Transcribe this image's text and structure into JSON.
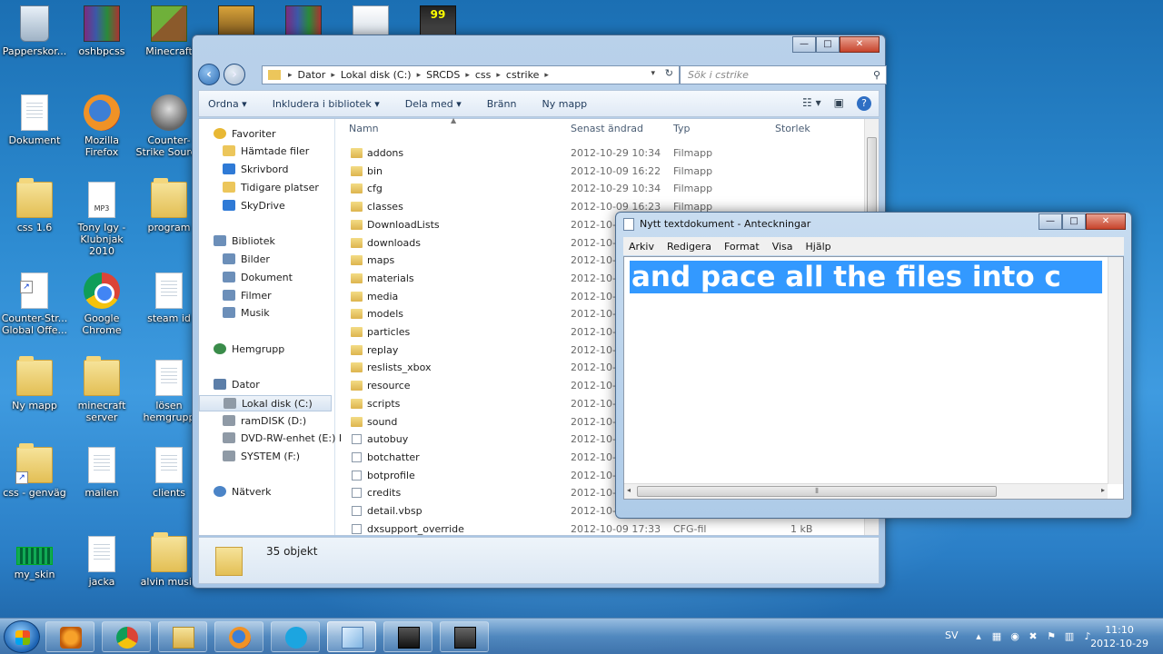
{
  "desktop": {
    "icons": [
      {
        "label": "Papperskor...",
        "kind": "trash"
      },
      {
        "label": "oshbpcss",
        "kind": "rar"
      },
      {
        "label": "Minecraft",
        "kind": "cube"
      },
      {
        "label": "",
        "kind": "game"
      },
      {
        "label": "",
        "kind": "rar"
      },
      {
        "label": "",
        "kind": "tv"
      },
      {
        "label": "",
        "kind": "99"
      },
      {
        "label": "Dokument",
        "kind": "doc"
      },
      {
        "label": "Mozilla Firefox",
        "kind": "firefox"
      },
      {
        "label": "Counter-Strike Source",
        "kind": "cs"
      },
      {
        "label": "css 1.6",
        "kind": "folder"
      },
      {
        "label": "Tony Igy - Klubnjak 2010",
        "kind": "mp3"
      },
      {
        "label": "program",
        "kind": "folder"
      },
      {
        "label": "Counter-Str... Global Offe...",
        "kind": "doc"
      },
      {
        "label": "Google Chrome",
        "kind": "chrome"
      },
      {
        "label": "steam id",
        "kind": "doc"
      },
      {
        "label": "Ny mapp",
        "kind": "folder"
      },
      {
        "label": "minecraft server",
        "kind": "folder"
      },
      {
        "label": "lösen hemgrupp",
        "kind": "doc"
      },
      {
        "label": "css - genväg",
        "kind": "folder"
      },
      {
        "label": "mailen",
        "kind": "doc"
      },
      {
        "label": "clients",
        "kind": "doc"
      },
      {
        "label": "my_skin",
        "kind": "skin"
      },
      {
        "label": "jacka",
        "kind": "doc"
      },
      {
        "label": "alvin musik",
        "kind": "folder"
      }
    ]
  },
  "explorer": {
    "title_buttons": {
      "minimize": "—",
      "maximize": "□",
      "close": "✕"
    },
    "breadcrumb": [
      "Dator",
      "Lokal disk (C:)",
      "SRCDS",
      "css",
      "cstrike"
    ],
    "search_placeholder": "Sök i cstrike",
    "toolbar": {
      "organize": "Ordna ▾",
      "include": "Inkludera i bibliotek ▾",
      "share": "Dela med ▾",
      "burn": "Bränn",
      "new_folder": "Ny mapp"
    },
    "nav": [
      {
        "label": "Favoriter",
        "icon": "star"
      },
      {
        "label": "Hämtade filer",
        "icon": "fold"
      },
      {
        "label": "Skrivbord",
        "icon": "blue"
      },
      {
        "label": "Tidigare platser",
        "icon": "fold"
      },
      {
        "label": "SkyDrive",
        "icon": "blue"
      },
      {
        "label": "Bibliotek",
        "icon": "lib"
      },
      {
        "label": "Bilder",
        "icon": "lib"
      },
      {
        "label": "Dokument",
        "icon": "lib"
      },
      {
        "label": "Filmer",
        "icon": "lib"
      },
      {
        "label": "Musik",
        "icon": "lib"
      },
      {
        "label": "Hemgrupp",
        "icon": "home"
      },
      {
        "label": "Dator",
        "icon": "comp"
      },
      {
        "label": "Lokal disk (C:)",
        "icon": "disk"
      },
      {
        "label": "ramDISK (D:)",
        "icon": "disk"
      },
      {
        "label": "DVD-RW-enhet (E:) I",
        "icon": "disk"
      },
      {
        "label": "SYSTEM (F:)",
        "icon": "disk"
      },
      {
        "label": "Nätverk",
        "icon": "net"
      }
    ],
    "columns": {
      "name": "Namn",
      "date": "Senast ändrad",
      "type": "Typ",
      "size": "Storlek"
    },
    "files": [
      {
        "name": "addons",
        "date": "2012-10-29 10:34",
        "type": "Filmapp",
        "size": "",
        "kind": "f"
      },
      {
        "name": "bin",
        "date": "2012-10-09 16:22",
        "type": "Filmapp",
        "size": "",
        "kind": "f"
      },
      {
        "name": "cfg",
        "date": "2012-10-29 10:34",
        "type": "Filmapp",
        "size": "",
        "kind": "f"
      },
      {
        "name": "classes",
        "date": "2012-10-09 16:23",
        "type": "Filmapp",
        "size": "",
        "kind": "f"
      },
      {
        "name": "DownloadLists",
        "date": "2012-10-",
        "type": "",
        "size": "",
        "kind": "f"
      },
      {
        "name": "downloads",
        "date": "2012-10-2",
        "type": "",
        "size": "",
        "kind": "f"
      },
      {
        "name": "maps",
        "date": "2012-10-2",
        "type": "",
        "size": "",
        "kind": "f"
      },
      {
        "name": "materials",
        "date": "2012-10-1",
        "type": "",
        "size": "",
        "kind": "f"
      },
      {
        "name": "media",
        "date": "2012-10-0",
        "type": "",
        "size": "",
        "kind": "f"
      },
      {
        "name": "models",
        "date": "2012-10-0",
        "type": "",
        "size": "",
        "kind": "f"
      },
      {
        "name": "particles",
        "date": "2012-10-0",
        "type": "",
        "size": "",
        "kind": "f"
      },
      {
        "name": "replay",
        "date": "2012-10-0",
        "type": "",
        "size": "",
        "kind": "f"
      },
      {
        "name": "reslists_xbox",
        "date": "2012-10-0",
        "type": "",
        "size": "",
        "kind": "f"
      },
      {
        "name": "resource",
        "date": "2012-10-0",
        "type": "",
        "size": "",
        "kind": "f"
      },
      {
        "name": "scripts",
        "date": "2012-10-0",
        "type": "",
        "size": "",
        "kind": "f"
      },
      {
        "name": "sound",
        "date": "2012-10-2",
        "type": "",
        "size": "",
        "kind": "f"
      },
      {
        "name": "autobuy",
        "date": "2012-10-0",
        "type": "",
        "size": "",
        "kind": "d"
      },
      {
        "name": "botchatter",
        "date": "2012-10-0",
        "type": "",
        "size": "",
        "kind": "d"
      },
      {
        "name": "botprofile",
        "date": "2012-10-0",
        "type": "",
        "size": "",
        "kind": "d"
      },
      {
        "name": "credits",
        "date": "2012-10-0",
        "type": "",
        "size": "",
        "kind": "d"
      },
      {
        "name": "detail.vbsp",
        "date": "2012-10-0",
        "type": "",
        "size": "",
        "kind": "d"
      },
      {
        "name": "dxsupport_override",
        "date": "2012-10-09 17:33",
        "type": "CFG-fil",
        "size": "1 kB",
        "kind": "d"
      }
    ],
    "status": "35 objekt"
  },
  "notepad": {
    "title": "Nytt textdokument - Anteckningar",
    "menu": [
      "Arkiv",
      "Redigera",
      "Format",
      "Visa",
      "Hjälp"
    ],
    "text": "and pace all the files into c",
    "title_buttons": {
      "minimize": "—",
      "maximize": "□",
      "close": "✕"
    }
  },
  "taskbar": {
    "apps": [
      "windows-media-player",
      "google-chrome",
      "windows-explorer",
      "mozilla-firefox",
      "skype",
      "notepad",
      "counter-strike-source",
      "counter-strike-global-offensive"
    ],
    "language": "SV",
    "time": "11:10",
    "date": "2012-10-29"
  }
}
